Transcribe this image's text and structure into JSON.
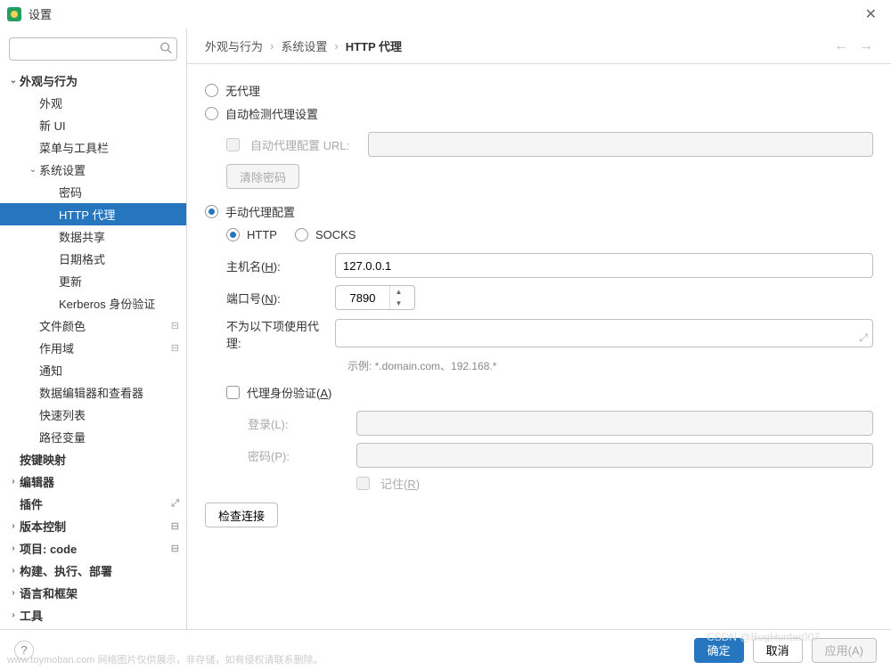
{
  "window": {
    "title": "设置"
  },
  "search": {
    "placeholder": ""
  },
  "sidebar": {
    "items": [
      {
        "label": "外观与行为",
        "depth": 0,
        "expanded": true,
        "hasChildren": true
      },
      {
        "label": "外观",
        "depth": 1
      },
      {
        "label": "新 UI",
        "depth": 1
      },
      {
        "label": "菜单与工具栏",
        "depth": 1
      },
      {
        "label": "系统设置",
        "depth": 1,
        "expanded": true,
        "hasChildren": true
      },
      {
        "label": "密码",
        "depth": 2
      },
      {
        "label": "HTTP 代理",
        "depth": 2,
        "selected": true
      },
      {
        "label": "数据共享",
        "depth": 2
      },
      {
        "label": "日期格式",
        "depth": 2
      },
      {
        "label": "更新",
        "depth": 2
      },
      {
        "label": "Kerberos 身份验证",
        "depth": 2
      },
      {
        "label": "文件颜色",
        "depth": 1,
        "badge": "⊟"
      },
      {
        "label": "作用域",
        "depth": 1,
        "badge": "⊟"
      },
      {
        "label": "通知",
        "depth": 1
      },
      {
        "label": "数据编辑器和查看器",
        "depth": 1
      },
      {
        "label": "快速列表",
        "depth": 1
      },
      {
        "label": "路径变量",
        "depth": 1
      },
      {
        "label": "按键映射",
        "depth": 0,
        "bold": true
      },
      {
        "label": "编辑器",
        "depth": 0,
        "hasChildren": true,
        "bold": true
      },
      {
        "label": "插件",
        "depth": 0,
        "bold": true,
        "badge": "⤢"
      },
      {
        "label": "版本控制",
        "depth": 0,
        "hasChildren": true,
        "bold": true,
        "badge": "⊟"
      },
      {
        "label": "项目: code",
        "depth": 0,
        "hasChildren": true,
        "bold": true,
        "badge": "⊟"
      },
      {
        "label": "构建、执行、部署",
        "depth": 0,
        "hasChildren": true,
        "bold": true
      },
      {
        "label": "语言和框架",
        "depth": 0,
        "hasChildren": true,
        "bold": true
      },
      {
        "label": "工具",
        "depth": 0,
        "hasChildren": true,
        "bold": true
      }
    ]
  },
  "breadcrumb": [
    "外观与行为",
    "系统设置",
    "HTTP 代理"
  ],
  "proxy": {
    "no_proxy": "无代理",
    "auto_detect": "自动检测代理设置",
    "auto_url_label": "自动代理配置 URL:",
    "auto_url_value": "",
    "clear_pw": "清除密码",
    "manual": "手动代理配置",
    "http": "HTTP",
    "socks": "SOCKS",
    "host_label": "主机名(H):",
    "host_value": "127.0.0.1",
    "port_label": "端口号(N):",
    "port_value": "7890",
    "no_proxy_for_label": "不为以下项使用代理:",
    "no_proxy_for_value": "",
    "example": "示例: *.domain.com、192.168.*",
    "auth_label": "代理身份验证(A)",
    "login_label": "登录(L):",
    "login_value": "",
    "pw_label": "密码(P):",
    "pw_value": "",
    "remember": "记住(R)",
    "check": "检查连接"
  },
  "footer": {
    "ok": "确定",
    "cancel": "取消",
    "apply": "应用(A)"
  },
  "watermark": "www.toymoban.com 网络图片仅供展示，非存储，如有侵权请联系删除。",
  "watermark2": "CSDN @BugHunter007"
}
